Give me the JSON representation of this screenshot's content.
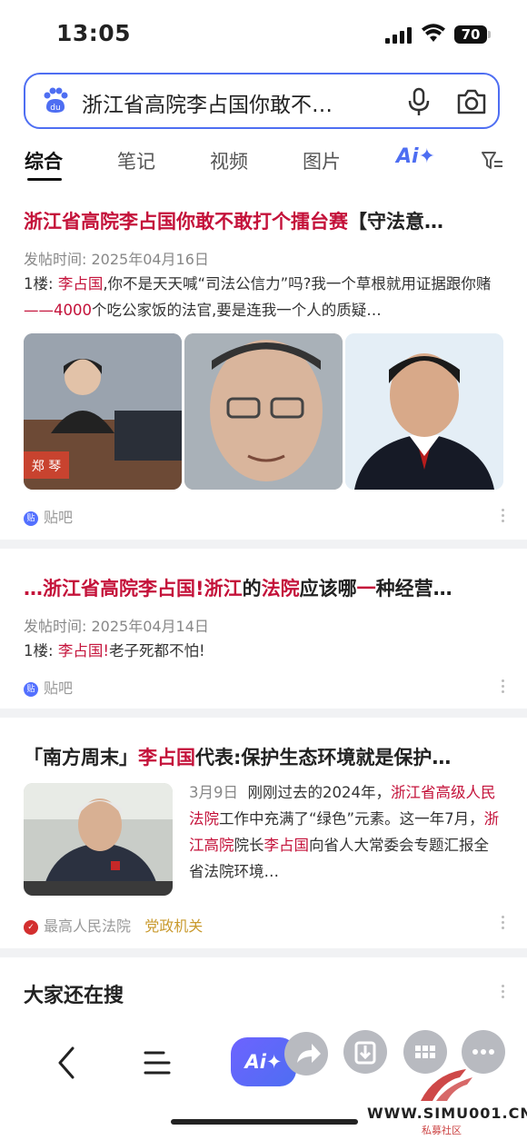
{
  "status_bar": {
    "time": "13:05",
    "battery": "70"
  },
  "search": {
    "query": "浙江省高院李占国你敢不…"
  },
  "tabs": [
    "综合",
    "笔记",
    "视频",
    "图片"
  ],
  "ai_tab_label": "Ai✦",
  "results": [
    {
      "title_parts": [
        "浙江省高院李占国你敢不敢打个擂台赛",
        "【守法意…"
      ],
      "date": "发帖时间: 2025年04月16日",
      "snippet_parts": [
        "1楼: ",
        "李占国",
        ",你不是天天喊“司法公信力”吗?我一个草根就用证据跟你赌",
        "——4000",
        "个吃公家饭的法官,要是连我一个人的质疑…"
      ],
      "source": "贴吧",
      "image_caption": "郑 琴"
    },
    {
      "title_parts": [
        "…",
        "浙江省高院李占国",
        "!",
        "浙江",
        "的",
        "法院",
        "应该哪",
        "一",
        "种经营…"
      ],
      "date": "发帖时间: 2025年04月14日",
      "snippet_parts": [
        "1楼: ",
        "李占国",
        "!",
        "老子死都不怕!"
      ],
      "source": "贴吧"
    },
    {
      "title_parts": [
        "「南方周末」",
        "李占国",
        "代表:保护生态环境就是保护…"
      ],
      "snippet_date": "3月9日",
      "snippet_parts": [
        "刚刚过去的2024年，",
        "浙江省高级人民法院",
        "工作中充满了“绿色”元素。这一年7月，",
        "浙江高院",
        "院长",
        "李占国",
        "向省人大常委会专题汇报全省法院环境…"
      ],
      "source": "最高人民法院",
      "source_tag": "党政机关"
    }
  ],
  "related_heading": "大家还在搜",
  "bottom_bar": {
    "ai_label": "Ai✦"
  },
  "watermark": {
    "text": "WWW.SIMU001.CN",
    "sub": "私募社区"
  },
  "colors": {
    "accent": "#4e6ef2",
    "highlight": "#c4123a",
    "tag": "#c99a2e"
  }
}
